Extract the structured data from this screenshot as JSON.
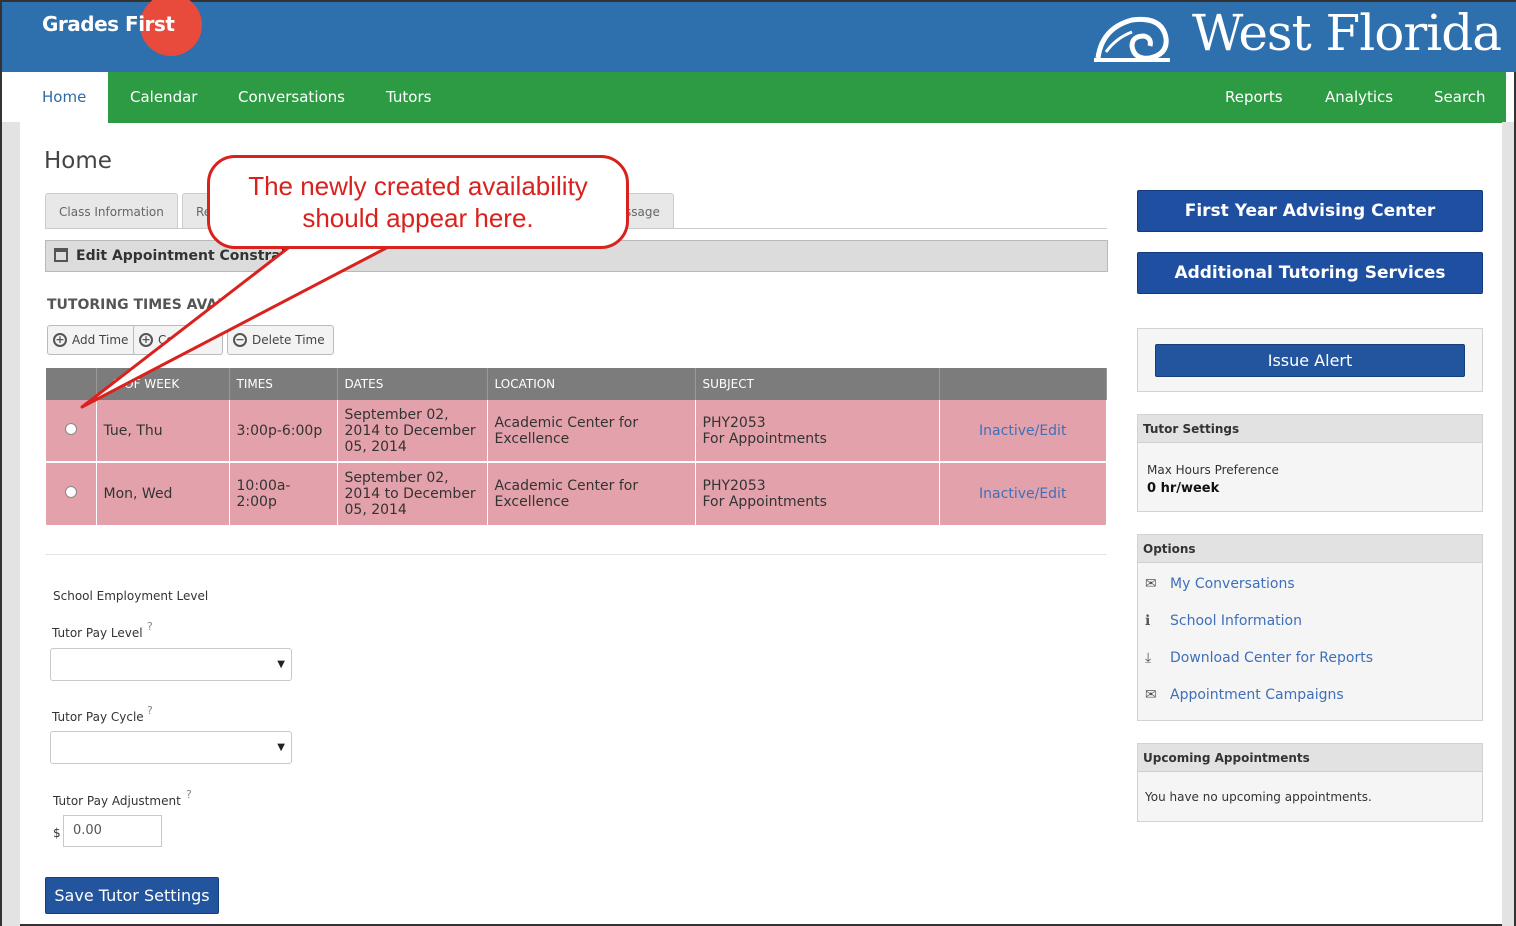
{
  "brand": {
    "grades": "Grades",
    "first": "First",
    "school": "West Florida"
  },
  "nav": {
    "left": [
      "Home",
      "Calendar",
      "Conversations",
      "Tutors"
    ],
    "right": [
      "Reports",
      "Analytics",
      "Search"
    ]
  },
  "page": {
    "title": "Home"
  },
  "tabs": [
    "Class Information",
    "Re",
    "ssage"
  ],
  "edit_bar": "Edit Appointment Constrain",
  "section_heading": "TUTORING TIMES AVAI",
  "toolbar": {
    "add": "Add Time",
    "copy": "Co",
    "delete": "Delete Time"
  },
  "table": {
    "headers": [
      "",
      "S OF WEEK",
      "TIMES",
      "DATES",
      "LOCATION",
      "SUBJECT",
      ""
    ],
    "header_prefix": "D",
    "rows": [
      {
        "days": "Tue, Thu",
        "times": "3:00p-6:00p",
        "dates": "September 02, 2014 to December 05, 2014",
        "location": "Academic Center for Excellence",
        "subject_code": "PHY2053",
        "subject_type": "For Appointments",
        "action": "Inactive/Edit"
      },
      {
        "days": "Mon, Wed",
        "times": "10:00a-2:00p",
        "dates": "September 02, 2014 to December 05, 2014",
        "location": "Academic Center for Excellence",
        "subject_code": "PHY2053",
        "subject_type": "For Appointments",
        "action": "Inactive/Edit"
      }
    ]
  },
  "form": {
    "employment_level": "School Employment Level",
    "pay_level": "Tutor Pay Level",
    "pay_cycle": "Tutor Pay Cycle",
    "pay_adjustment": "Tutor Pay Adjustment",
    "help": "?",
    "dollar": "$",
    "adjustment_value": "0.00",
    "save": "Save Tutor Settings"
  },
  "sidebar": {
    "btn1": "First Year Advising Center",
    "btn2": "Additional Tutoring Services",
    "issue_alert": "Issue Alert",
    "tutor_settings": {
      "title": "Tutor Settings",
      "label": "Max Hours Preference",
      "value": "0 hr/week"
    },
    "options": {
      "title": "Options",
      "items": [
        "My Conversations",
        "School Information",
        "Download Center for Reports",
        "Appointment Campaigns"
      ]
    },
    "upcoming": {
      "title": "Upcoming Appointments",
      "text": "You have no upcoming appointments."
    }
  },
  "callout": {
    "line1": "The newly created availability",
    "line2": "should appear here."
  },
  "colors": {
    "topbar": "#2e6fad",
    "navbar": "#2d9b43",
    "row": "#e3a2ab",
    "button": "#1f4fa0",
    "callout": "#d9221e"
  }
}
